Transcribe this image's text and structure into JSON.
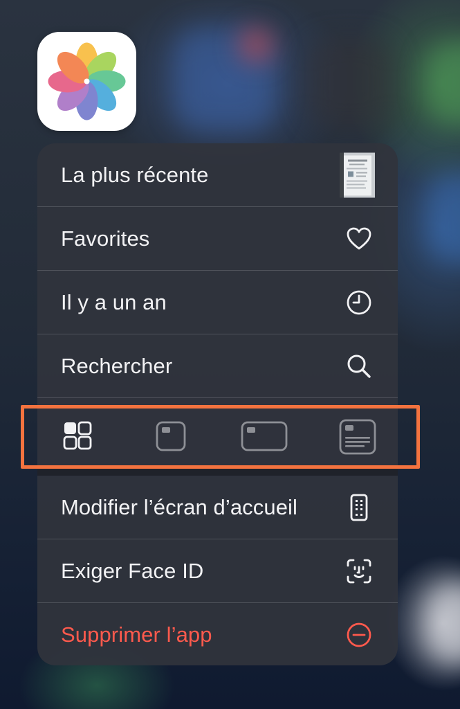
{
  "app": {
    "name_icon": "photos-app-icon"
  },
  "menu": {
    "recent_label": "La plus récente",
    "favorites_label": "Favorites",
    "one_year_ago_label": "Il y a un an",
    "search_label": "Rechercher",
    "widget_sizes": [
      "widget-grid-icon",
      "widget-small-icon",
      "widget-medium-icon",
      "widget-large-icon"
    ],
    "edit_home_label": "Modifier l’écran d’accueil",
    "face_id_label": "Exiger Face ID",
    "delete_app_label": "Supprimer l’app"
  },
  "colors": {
    "destructive": "#ff5a4d",
    "highlight_border": "#f4733f"
  }
}
